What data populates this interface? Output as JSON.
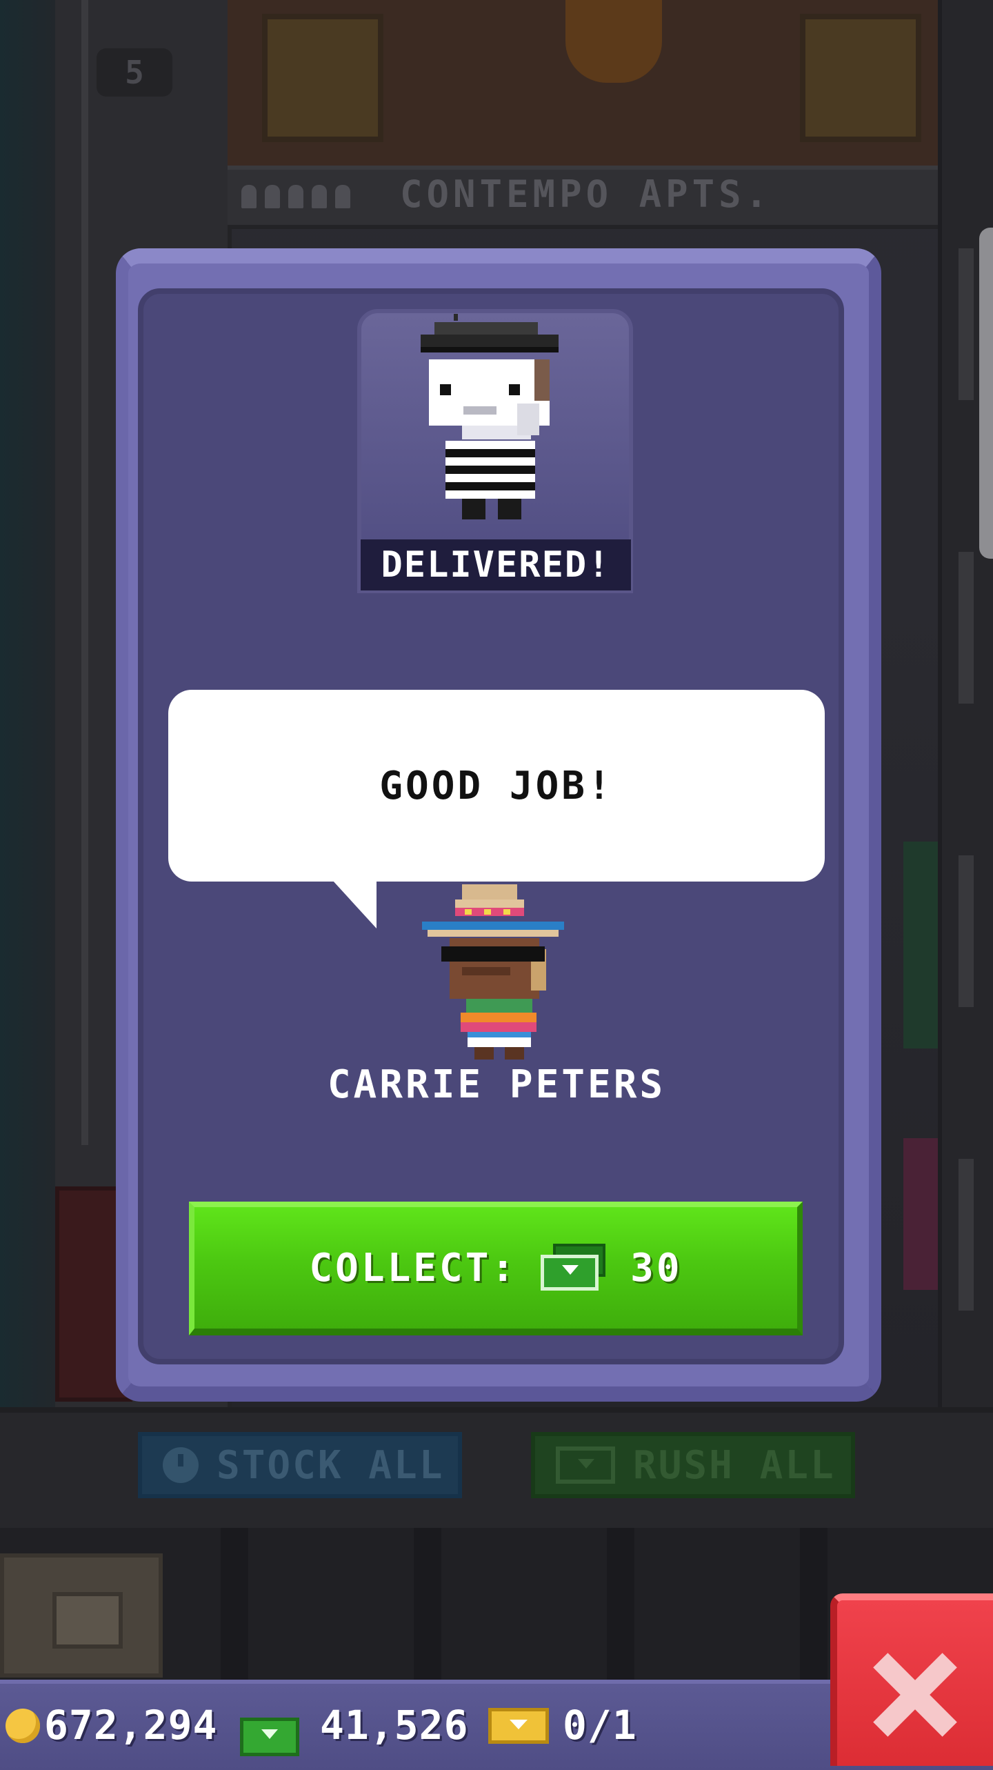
{
  "background": {
    "floor_number": "5",
    "floor_sign": "CONTEMPO APTS.",
    "stock_all_label": "STOCK ALL",
    "rush_all_label": "RUSH ALL"
  },
  "modal": {
    "status_banner": "DELIVERED!",
    "speech": "GOOD JOB!",
    "bitizen_name": "CARRIE PETERS",
    "collect": {
      "label": "COLLECT:",
      "amount": "30",
      "currency_icon": "bux-icon"
    }
  },
  "currency": {
    "coins": "672,294",
    "bux": "41,526",
    "tickets": "0/1"
  },
  "icons": {
    "coin": "coin-icon",
    "bux": "bux-icon",
    "ticket": "ticket-icon",
    "close": "close-icon",
    "clock": "clock-icon"
  },
  "colors": {
    "modal_frame": "#736fb2",
    "modal_inner": "#4b4879",
    "collect_green": "#4cc811",
    "close_red": "#dc2d34",
    "coin_gold": "#f5c642"
  }
}
